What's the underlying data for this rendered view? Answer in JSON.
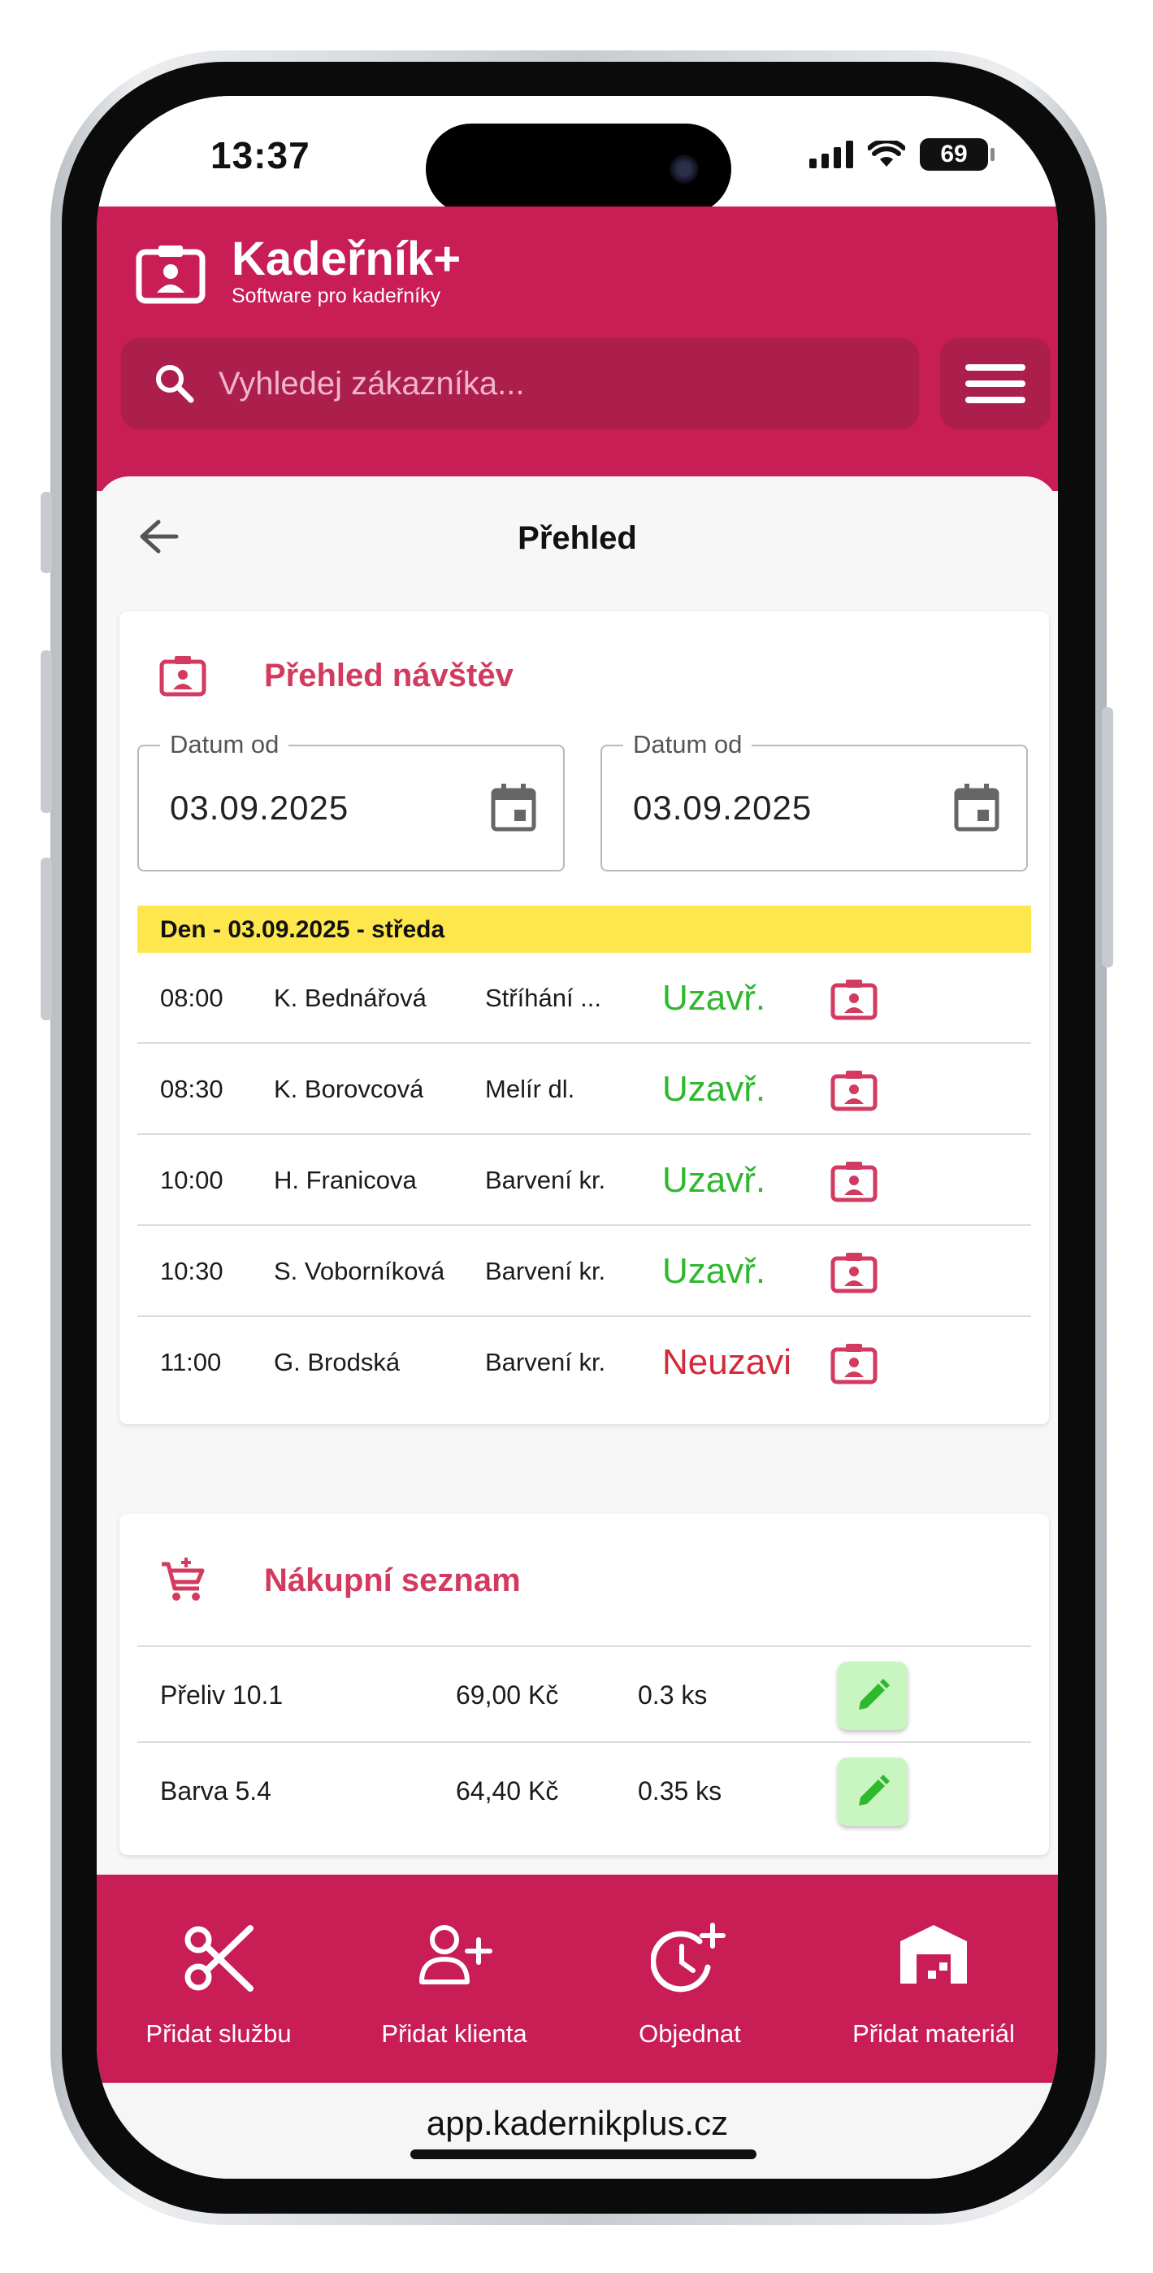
{
  "status": {
    "time": "13:37",
    "battery": "69"
  },
  "header": {
    "app_name": "Kadeřník+",
    "app_subtitle": "Software pro kadeřníky",
    "search_placeholder": "Vyhledej zákazníka...",
    "accent_color": "#c81d55"
  },
  "page": {
    "title": "Přehled"
  },
  "visits": {
    "title": "Přehled návštěv",
    "date_from_label": "Datum od",
    "date_from_value": "03.09.2025",
    "date_to_label": "Datum od",
    "date_to_value": "03.09.2025",
    "day_label": "Den - 03.09.2025 - středa",
    "rows": [
      {
        "time": "08:00",
        "client": "K. Bednářová",
        "service": "Stříhání ...",
        "status": "Uzavř.",
        "closed": true
      },
      {
        "time": "08:30",
        "client": "K. Borovcová",
        "service": "Melír dl.",
        "status": "Uzavř.",
        "closed": true
      },
      {
        "time": "10:00",
        "client": "H. Franicova",
        "service": "Barvení kr.",
        "status": "Uzavř.",
        "closed": true
      },
      {
        "time": "10:30",
        "client": "S. Voborníková",
        "service": "Barvení kr.",
        "status": "Uzavř.",
        "closed": true
      },
      {
        "time": "11:00",
        "client": "G. Brodská",
        "service": "Barvení kr.",
        "status": "Neuzavi",
        "closed": false
      }
    ]
  },
  "shopping": {
    "title": "Nákupní seznam",
    "rows": [
      {
        "item": "Přeliv 10.1",
        "price": "69,00 Kč",
        "qty": "0.3 ks"
      },
      {
        "item": "Barva 5.4",
        "price": "64,40 Kč",
        "qty": "0.35 ks"
      }
    ]
  },
  "bottom_nav": [
    {
      "label": "Přidat službu",
      "icon": "scissors-icon"
    },
    {
      "label": "Přidat klienta",
      "icon": "add-person-icon"
    },
    {
      "label": "Objednat",
      "icon": "clock-plus-icon"
    },
    {
      "label": "Přidat materiál",
      "icon": "warehouse-icon"
    }
  ],
  "browser": {
    "url": "app.kadernikplus.cz"
  }
}
